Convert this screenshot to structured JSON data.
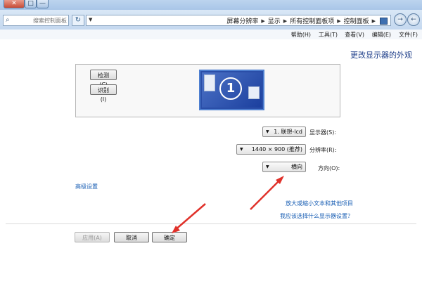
{
  "window": {
    "close_glyph": "✕",
    "max_glyph": "□",
    "min_glyph": "—"
  },
  "toolbar": {
    "search_placeholder": "搜索控制面板",
    "refresh_glyph": "↻",
    "address_dropdown_glyph": "▼",
    "breadcrumb": [
      "控制面板",
      "所有控制面板项",
      "显示",
      "屏幕分辨率"
    ],
    "breadcrumb_sep": "▶"
  },
  "menu": [
    "文件(F)",
    "编辑(E)",
    "查看(V)",
    "工具(T)",
    "帮助(H)"
  ],
  "main": {
    "title": "更改显示器的外观",
    "detect_button": "检测(C)",
    "identify_button": "识别(I)",
    "monitor_number": "1",
    "display_label": "显示器(S):",
    "display_value": "1. 联想-lcd",
    "resolution_label": "分辨率(R):",
    "resolution_value": "1440 × 900 (推荐)",
    "orientation_label": "方向(O):",
    "orientation_value": "横向",
    "advanced_link": "高级设置",
    "link_text_size": "放大或缩小文本和其他项目",
    "link_which_settings": "我应该选择什么显示器设置？",
    "ok_button": "确定",
    "cancel_button": "取消",
    "apply_button": "应用(A)"
  },
  "colors": {
    "annotation_arrow": "#e0312a",
    "link": "#1a5fb4",
    "heading": "#1f3f8a"
  }
}
